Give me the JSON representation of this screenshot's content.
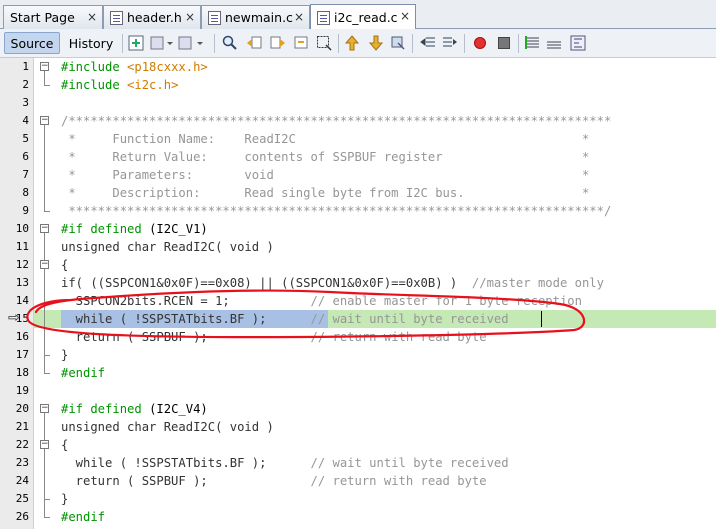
{
  "tabs": [
    {
      "label": "Start Page",
      "active": false
    },
    {
      "label": "header.h",
      "active": false
    },
    {
      "label": "newmain.c",
      "active": false
    },
    {
      "label": "i2c_read.c",
      "active": true
    }
  ],
  "toolbar": {
    "source_label": "Source",
    "history_label": "History"
  },
  "icons": {
    "close": "×",
    "debug_arrow": "⇨"
  },
  "lines": [
    {
      "n": "1",
      "parts": [
        [
          "pp",
          "#include "
        ],
        [
          "str",
          "<p18cxxx.h>"
        ]
      ]
    },
    {
      "n": "2",
      "parts": [
        [
          "pp",
          "#include "
        ],
        [
          "str",
          "<i2c.h>"
        ]
      ]
    },
    {
      "n": "3",
      "parts": []
    },
    {
      "n": "4",
      "parts": [
        [
          "cm",
          "/**************************************************************************"
        ]
      ]
    },
    {
      "n": "5",
      "parts": [
        [
          "cm",
          " *     Function Name:    ReadI2C                                       *"
        ]
      ]
    },
    {
      "n": "6",
      "parts": [
        [
          "cm",
          " *     Return Value:     contents of SSPBUF register                   *"
        ]
      ]
    },
    {
      "n": "7",
      "parts": [
        [
          "cm",
          " *     Parameters:       void                                          *"
        ]
      ]
    },
    {
      "n": "8",
      "parts": [
        [
          "cm",
          " *     Description:      Read single byte from I2C bus.                *"
        ]
      ]
    },
    {
      "n": "9",
      "parts": [
        [
          "cm",
          " *************************************************************************/"
        ]
      ]
    },
    {
      "n": "10",
      "parts": [
        [
          "pp",
          "#if defined "
        ],
        [
          "kw",
          "(I2C_V1)"
        ]
      ]
    },
    {
      "n": "11",
      "parts": [
        [
          "tx",
          "unsigned char ReadI2C( void )"
        ]
      ]
    },
    {
      "n": "12",
      "parts": [
        [
          "tx",
          "{"
        ]
      ]
    },
    {
      "n": "13",
      "parts": [
        [
          "tx",
          "if( ((SSPCON1&0x0F)==0x08) || ((SSPCON1&0x0F)==0x0B) )  "
        ],
        [
          "cm",
          "//master mode only"
        ]
      ]
    },
    {
      "n": "14",
      "parts": [
        [
          "tx",
          "  SSPCON2bits.RCEN = 1;           "
        ],
        [
          "cm",
          "// enable master for 1 byte reception"
        ]
      ]
    },
    {
      "n": "15",
      "parts": [
        [
          "tx",
          "  while ( !SSPSTATbits.BF );      "
        ],
        [
          "cm",
          "// wait until byte received"
        ]
      ]
    },
    {
      "n": "16",
      "parts": [
        [
          "tx",
          "  return ( SSPBUF );              "
        ],
        [
          "cm",
          "// return with read byte"
        ]
      ]
    },
    {
      "n": "17",
      "parts": [
        [
          "tx",
          "}"
        ]
      ]
    },
    {
      "n": "18",
      "parts": [
        [
          "pp",
          "#endif"
        ]
      ]
    },
    {
      "n": "19",
      "parts": []
    },
    {
      "n": "20",
      "parts": [
        [
          "pp",
          "#if defined "
        ],
        [
          "kw",
          "(I2C_V4)"
        ]
      ]
    },
    {
      "n": "21",
      "parts": [
        [
          "tx",
          "unsigned char ReadI2C( void )"
        ]
      ]
    },
    {
      "n": "22",
      "parts": [
        [
          "tx",
          "{"
        ]
      ]
    },
    {
      "n": "23",
      "parts": [
        [
          "tx",
          "  while ( !SSPSTATbits.BF );      "
        ],
        [
          "cm",
          "// wait until byte received"
        ]
      ]
    },
    {
      "n": "24",
      "parts": [
        [
          "tx",
          "  return ( SSPBUF );              "
        ],
        [
          "cm",
          "// return with read byte"
        ]
      ]
    },
    {
      "n": "25",
      "parts": [
        [
          "tx",
          "}"
        ]
      ]
    },
    {
      "n": "26",
      "parts": [
        [
          "pp",
          "#endif"
        ]
      ]
    }
  ],
  "colors": {
    "annotation": "#e8101a",
    "current_line": "#c5e9b4",
    "selection": "#a8c0e4"
  }
}
